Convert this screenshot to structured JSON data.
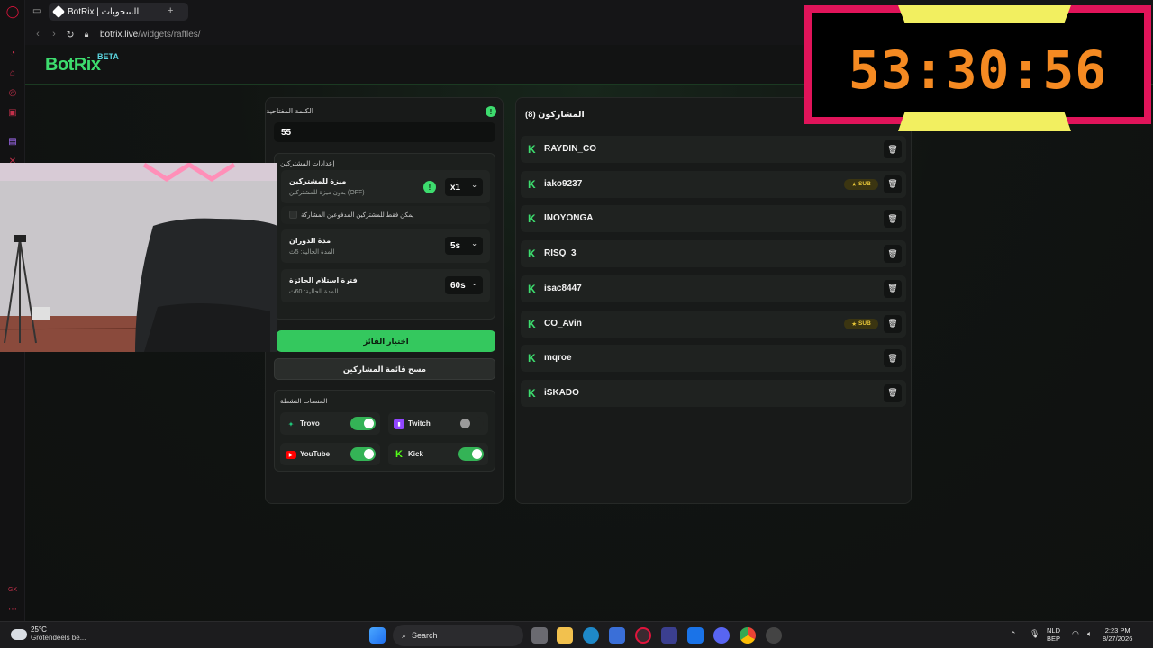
{
  "browser": {
    "tab_title": "BotRix | السحوبات",
    "new_tab": "+",
    "url_host": "botrix.live",
    "url_path": "/widgets/raffles/"
  },
  "app": {
    "logo": "BotRix",
    "beta": "BETA"
  },
  "left_panel": {
    "keyword_label": "الكلمة المفتاحية",
    "info_glyph": "!",
    "keyword_value": "55",
    "participant_settings_title": "إعدادات المشتركين",
    "subscriber_bonus": {
      "title": "ميزة للمشتركين",
      "subtitle": "بدون ميزة للمشتركين (OFF)",
      "value": "x1"
    },
    "only_subs_label": "يمكن فقط للمشتركين المدفوعين المشاركة",
    "spin_duration": {
      "title": "مدة الدوران",
      "subtitle": "المدة الحالية: 5ث",
      "value": "5s"
    },
    "claim_period": {
      "title": "فترة استلام الجائزة",
      "subtitle": "المدة الحالية: 60ث",
      "value": "60s"
    },
    "pick_winner_label": "اختيار الفائز",
    "clear_list_label": "مسح قائمة المشاركين",
    "active_platforms_title": "المنصات النشطة",
    "platforms": [
      {
        "name": "Trovo",
        "enabled": true,
        "color": "#1fc77a"
      },
      {
        "name": "Twitch",
        "enabled": false,
        "color": "#9146ff"
      },
      {
        "name": "YouTube",
        "enabled": true,
        "color": "#ff0000"
      },
      {
        "name": "Kick",
        "enabled": true,
        "color": "#53fc18"
      }
    ]
  },
  "right_panel": {
    "title": "المشاركون (8)",
    "sub_badge": "SUB",
    "participants": [
      {
        "name": "RAYDIN_CO",
        "sub": false
      },
      {
        "name": "iako9237",
        "sub": true
      },
      {
        "name": "INOYONGA",
        "sub": false
      },
      {
        "name": "RISQ_3",
        "sub": false
      },
      {
        "name": "isac8447",
        "sub": false
      },
      {
        "name": "CO_Avin",
        "sub": true
      },
      {
        "name": "mqroe",
        "sub": false
      },
      {
        "name": "iSKADO",
        "sub": false
      }
    ]
  },
  "timer": {
    "display": "53:30:56",
    "color": "#f58a22",
    "frame_color": "#e0145a",
    "accent": "#f2ef60"
  },
  "taskbar": {
    "temperature": "25°C",
    "condition": "Grotendeels be...",
    "search_label": "Search",
    "language": "NLD",
    "keyboard": "BEP",
    "time": "2:23 PM",
    "date": "8/27/2026"
  },
  "colors": {
    "accent_green": "#3ddc6e",
    "panel_bg": "#181a19"
  }
}
